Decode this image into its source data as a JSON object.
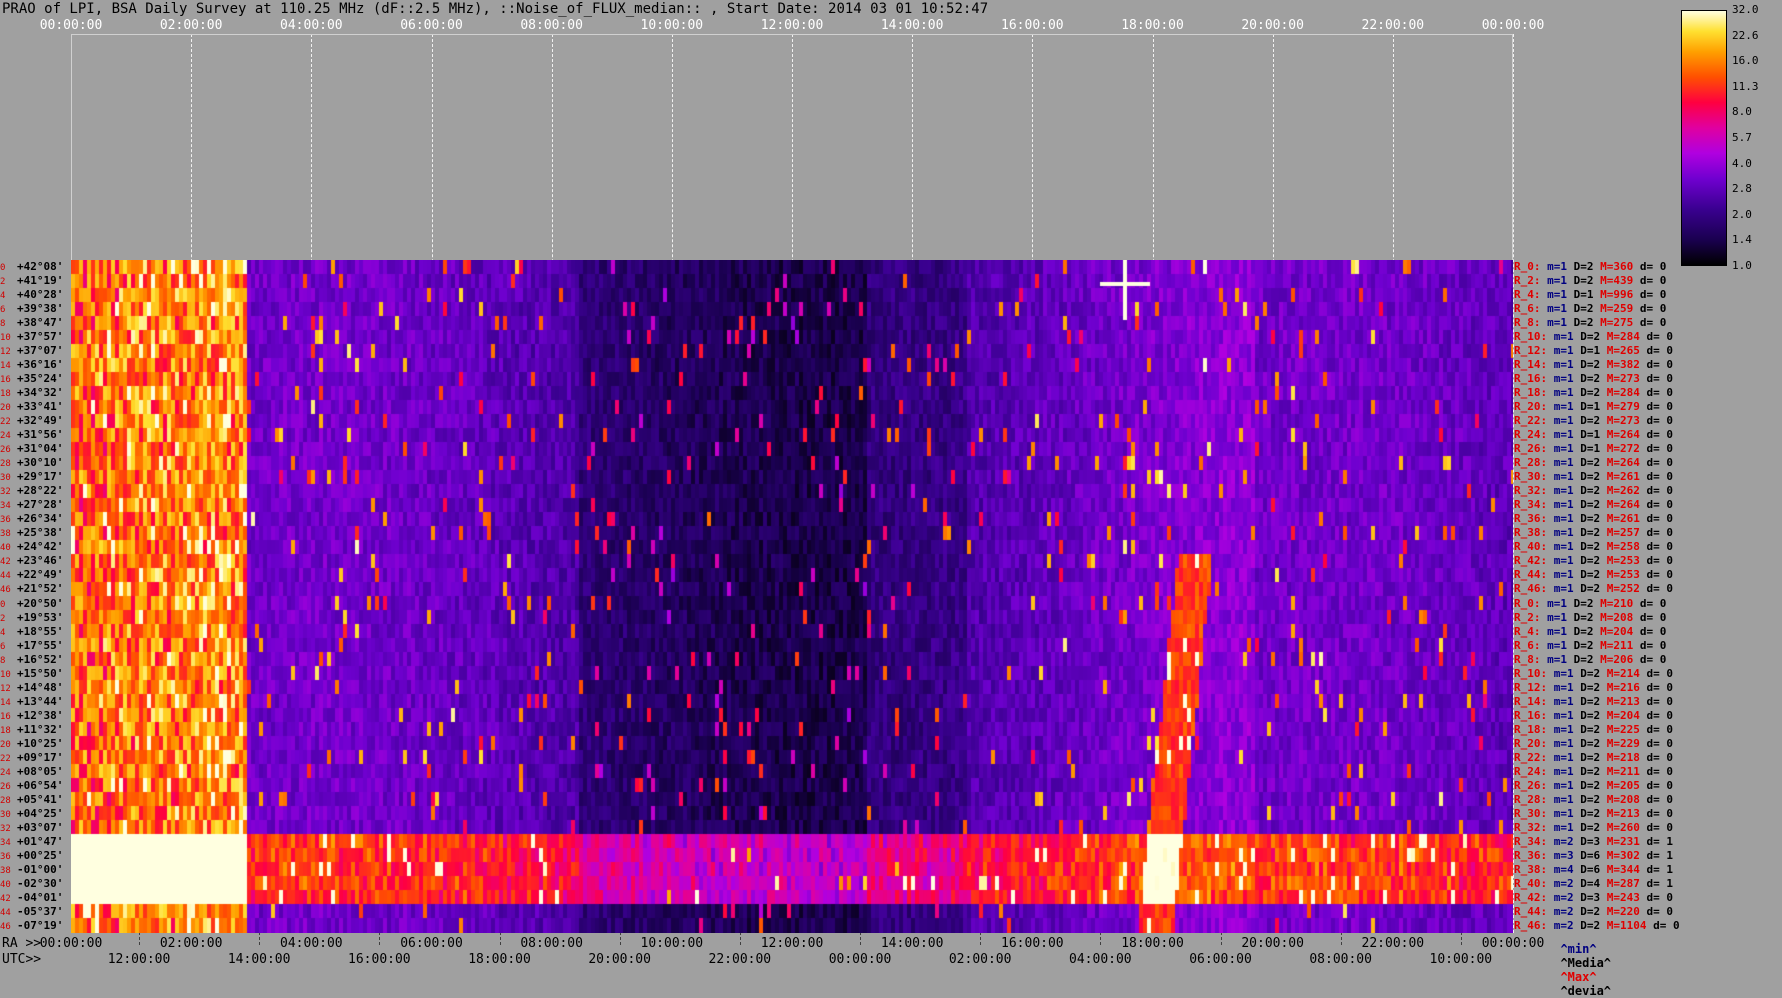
{
  "title": "PRAO of LPI, BSA Daily Survey at 110.25 MHz (dF::2.5 MHz), ::Noise_of_FLUX_median:: , Start Date: 2014 03 01 10:52:47",
  "top_axis": {
    "ticks": [
      "00:00:00",
      "02:00:00",
      "04:00:00",
      "06:00:00",
      "08:00:00",
      "10:00:00",
      "12:00:00",
      "14:00:00",
      "16:00:00",
      "18:00:00",
      "20:00:00",
      "22:00:00",
      "00:00:00"
    ]
  },
  "bottom_axis": {
    "ra_prefix": "RA >>",
    "utc_prefix": "UTC>>",
    "ra_ticks": [
      "00:00:00",
      "02:00:00",
      "04:00:00",
      "06:00:00",
      "08:00:00",
      "10:00:00",
      "12:00:00",
      "14:00:00",
      "16:00:00",
      "18:00:00",
      "20:00:00",
      "22:00:00",
      "00:00:00"
    ],
    "utc_ticks": [
      "12:00:00",
      "14:00:00",
      "16:00:00",
      "18:00:00",
      "20:00:00",
      "22:00:00",
      "00:00:00",
      "02:00:00",
      "04:00:00",
      "06:00:00",
      "08:00:00",
      "10:00:00"
    ]
  },
  "colorbar": {
    "ticks": [
      "32.0",
      "22.6",
      "16.0",
      "11.3",
      "8.0",
      "5.7",
      "4.0",
      "2.8",
      "2.0",
      "1.4",
      "1.0"
    ],
    "scale": "log"
  },
  "legend": {
    "min": "^min^",
    "median": "^Media^",
    "max": "^Max^",
    "dev": "^devia^"
  },
  "colors": {
    "background": "#a0a0a0",
    "min": "#000080",
    "max": "#e00000"
  },
  "chart_data": {
    "type": "heatmap",
    "x_axis": "RA / UTC (hours)",
    "y_axis": "Declination",
    "declinations": [
      "+42°08'",
      "+41°19'",
      "+40°28'",
      "+39°38'",
      "+38°47'",
      "+37°57'",
      "+37°07'",
      "+36°16'",
      "+35°24'",
      "+34°32'",
      "+33°41'",
      "+32°49'",
      "+31°56'",
      "+31°04'",
      "+30°10'",
      "+29°17'",
      "+28°22'",
      "+27°28'",
      "+26°34'",
      "+25°38'",
      "+24°42'",
      "+23°46'",
      "+22°49'",
      "+21°52'",
      "+20°50'",
      "+19°53'",
      "+18°55'",
      "+17°55'",
      "+16°52'",
      "+15°50'",
      "+14°48'",
      "+13°44'",
      "+12°38'",
      "+11°32'",
      "+10°25'",
      "+09°17'",
      "+08°05'",
      "+06°54'",
      "+05°41'",
      "+04°25'",
      "+03°07'",
      "+01°47'",
      "+00°25'",
      "-01°00'",
      "-02°30'",
      "-04°01'",
      "-05°37'",
      "-07°19'"
    ],
    "beam_indices": [
      0,
      2,
      4,
      6,
      8,
      10,
      12,
      14,
      16,
      18,
      20,
      22,
      24,
      26,
      28,
      30,
      32,
      34,
      36,
      38,
      40,
      42,
      44,
      46,
      0,
      2,
      4,
      6,
      8,
      10,
      12,
      14,
      16,
      18,
      20,
      22,
      24,
      26,
      28,
      30,
      32,
      34,
      36,
      38,
      40,
      42,
      44,
      46
    ],
    "beam_stats": [
      {
        "name": "R_0:",
        "min": "m=1",
        "med": "D=2",
        "max": "M=360",
        "dev": "d= 0"
      },
      {
        "name": "R_2:",
        "min": "m=1",
        "med": "D=2",
        "max": "M=439",
        "dev": "d= 0"
      },
      {
        "name": "R_4:",
        "min": "m=1",
        "med": "D=1",
        "max": "M=996",
        "dev": "d= 0"
      },
      {
        "name": "R_6:",
        "min": "m=1",
        "med": "D=2",
        "max": "M=259",
        "dev": "d= 0"
      },
      {
        "name": "R_8:",
        "min": "m=1",
        "med": "D=2",
        "max": "M=275",
        "dev": "d= 0"
      },
      {
        "name": "R_10:",
        "min": "m=1",
        "med": "D=2",
        "max": "M=284",
        "dev": "d= 0"
      },
      {
        "name": "R_12:",
        "min": "m=1",
        "med": "D=1",
        "max": "M=265",
        "dev": "d= 0"
      },
      {
        "name": "R_14:",
        "min": "m=1",
        "med": "D=2",
        "max": "M=382",
        "dev": "d= 0"
      },
      {
        "name": "R_16:",
        "min": "m=1",
        "med": "D=2",
        "max": "M=273",
        "dev": "d= 0"
      },
      {
        "name": "R_18:",
        "min": "m=1",
        "med": "D=2",
        "max": "M=284",
        "dev": "d= 0"
      },
      {
        "name": "R_20:",
        "min": "m=1",
        "med": "D=1",
        "max": "M=279",
        "dev": "d= 0"
      },
      {
        "name": "R_22:",
        "min": "m=1",
        "med": "D=2",
        "max": "M=273",
        "dev": "d= 0"
      },
      {
        "name": "R_24:",
        "min": "m=1",
        "med": "D=1",
        "max": "M=264",
        "dev": "d= 0"
      },
      {
        "name": "R_26:",
        "min": "m=1",
        "med": "D=1",
        "max": "M=272",
        "dev": "d= 0"
      },
      {
        "name": "R_28:",
        "min": "m=1",
        "med": "D=2",
        "max": "M=264",
        "dev": "d= 0"
      },
      {
        "name": "R_30:",
        "min": "m=1",
        "med": "D=2",
        "max": "M=261",
        "dev": "d= 0"
      },
      {
        "name": "R_32:",
        "min": "m=1",
        "med": "D=2",
        "max": "M=262",
        "dev": "d= 0"
      },
      {
        "name": "R_34:",
        "min": "m=1",
        "med": "D=2",
        "max": "M=264",
        "dev": "d= 0"
      },
      {
        "name": "R_36:",
        "min": "m=1",
        "med": "D=2",
        "max": "M=261",
        "dev": "d= 0"
      },
      {
        "name": "R_38:",
        "min": "m=1",
        "med": "D=2",
        "max": "M=257",
        "dev": "d= 0"
      },
      {
        "name": "R_40:",
        "min": "m=1",
        "med": "D=2",
        "max": "M=258",
        "dev": "d= 0"
      },
      {
        "name": "R_42:",
        "min": "m=1",
        "med": "D=2",
        "max": "M=253",
        "dev": "d= 0"
      },
      {
        "name": "R_44:",
        "min": "m=1",
        "med": "D=2",
        "max": "M=253",
        "dev": "d= 0"
      },
      {
        "name": "R_46:",
        "min": "m=1",
        "med": "D=2",
        "max": "M=252",
        "dev": "d= 0"
      },
      {
        "name": "R_0:",
        "min": "m=1",
        "med": "D=2",
        "max": "M=210",
        "dev": "d= 0"
      },
      {
        "name": "R_2:",
        "min": "m=1",
        "med": "D=2",
        "max": "M=208",
        "dev": "d= 0"
      },
      {
        "name": "R_4:",
        "min": "m=1",
        "med": "D=2",
        "max": "M=204",
        "dev": "d= 0"
      },
      {
        "name": "R_6:",
        "min": "m=1",
        "med": "D=2",
        "max": "M=211",
        "dev": "d= 0"
      },
      {
        "name": "R_8:",
        "min": "m=1",
        "med": "D=2",
        "max": "M=206",
        "dev": "d= 0"
      },
      {
        "name": "R_10:",
        "min": "m=1",
        "med": "D=2",
        "max": "M=214",
        "dev": "d= 0"
      },
      {
        "name": "R_12:",
        "min": "m=1",
        "med": "D=2",
        "max": "M=216",
        "dev": "d= 0"
      },
      {
        "name": "R_14:",
        "min": "m=1",
        "med": "D=2",
        "max": "M=213",
        "dev": "d= 0"
      },
      {
        "name": "R_16:",
        "min": "m=1",
        "med": "D=2",
        "max": "M=204",
        "dev": "d= 0"
      },
      {
        "name": "R_18:",
        "min": "m=1",
        "med": "D=2",
        "max": "M=225",
        "dev": "d= 0"
      },
      {
        "name": "R_20:",
        "min": "m=1",
        "med": "D=2",
        "max": "M=229",
        "dev": "d= 0"
      },
      {
        "name": "R_22:",
        "min": "m=1",
        "med": "D=2",
        "max": "M=218",
        "dev": "d= 0"
      },
      {
        "name": "R_24:",
        "min": "m=1",
        "med": "D=2",
        "max": "M=211",
        "dev": "d= 0"
      },
      {
        "name": "R_26:",
        "min": "m=1",
        "med": "D=2",
        "max": "M=205",
        "dev": "d= 0"
      },
      {
        "name": "R_28:",
        "min": "m=1",
        "med": "D=2",
        "max": "M=208",
        "dev": "d= 0"
      },
      {
        "name": "R_30:",
        "min": "m=1",
        "med": "D=2",
        "max": "M=213",
        "dev": "d= 0"
      },
      {
        "name": "R_32:",
        "min": "m=1",
        "med": "D=2",
        "max": "M=260",
        "dev": "d= 0"
      },
      {
        "name": "R_34:",
        "min": "m=2",
        "med": "D=3",
        "max": "M=231",
        "dev": "d= 1"
      },
      {
        "name": "R_36:",
        "min": "m=3",
        "med": "D=6",
        "max": "M=302",
        "dev": "d= 1"
      },
      {
        "name": "R_38:",
        "min": "m=4",
        "med": "D=6",
        "max": "M=344",
        "dev": "d= 1"
      },
      {
        "name": "R_40:",
        "min": "m=2",
        "med": "D=4",
        "max": "M=287",
        "dev": "d= 1"
      },
      {
        "name": "R_42:",
        "min": "m=2",
        "med": "D=3",
        "max": "M=243",
        "dev": "d= 0"
      },
      {
        "name": "R_44:",
        "min": "m=2",
        "med": "D=2",
        "max": "M=220",
        "dev": "d= 0"
      },
      {
        "name": "R_46:",
        "min": "m=2",
        "med": "D=2",
        "max": "M=1104",
        "dev": "d= 0"
      }
    ]
  }
}
